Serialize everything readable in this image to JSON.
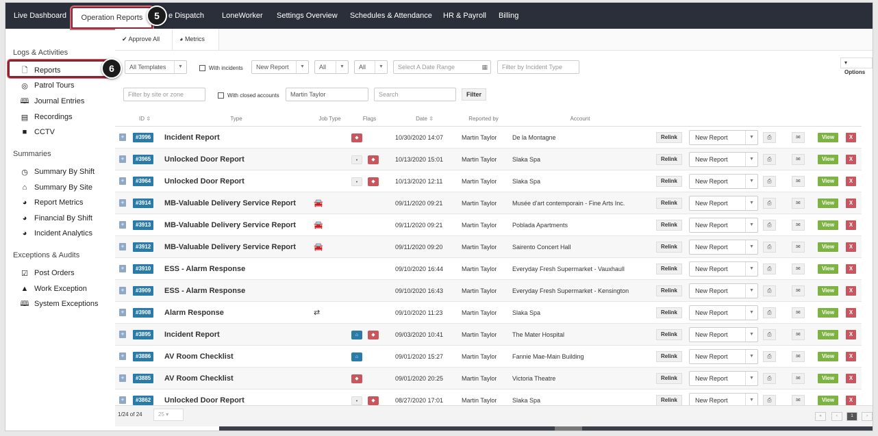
{
  "topnav": {
    "items": [
      "Live Dashboard",
      "Operation Reports",
      "e Dispatch",
      "LoneWorker",
      "Settings Overview",
      "Schedules & Attendance",
      "HR & Payroll",
      "Billing"
    ],
    "callout_nav": "5",
    "callout_side": "6"
  },
  "sidebar": {
    "logs_title": "Logs & Activities",
    "logs": [
      "Reports",
      "Patrol Tours",
      "Journal Entries",
      "Recordings",
      "CCTV"
    ],
    "summaries_title": "Summaries",
    "summaries": [
      "Summary By Shift",
      "Summary By Site",
      "Report Metrics",
      "Financial By Shift",
      "Incident Analytics"
    ],
    "exceptions_title": "Exceptions & Audits",
    "exceptions": [
      "Post Orders",
      "Work Exception",
      "System Exceptions"
    ]
  },
  "subbar": {
    "approve_all": "Approve All",
    "metrics": "Metrics"
  },
  "filters": {
    "templates": "All Templates",
    "with_incidents": "With incidents",
    "new_report": "New Report",
    "all1": "All",
    "all2": "All",
    "date_placeholder": "Select A Date Range",
    "incident_placeholder": "Filter by Incident Type",
    "options": "Options",
    "site_placeholder": "Filter by site or zone",
    "with_closed": "With closed accounts",
    "reporter": "Martin Taylor",
    "search_placeholder": "Search",
    "filter_button": "Filter"
  },
  "table": {
    "headers": [
      "ID",
      "Type",
      "Job Type",
      "Flags",
      "Date",
      "Reported by",
      "Account"
    ],
    "relink_label": "Relink",
    "select_label": "New Report",
    "view_label": "View",
    "delete_label": "X",
    "rows": [
      {
        "id": "#3996",
        "type": "Incident Report",
        "job": "",
        "flags": [
          "tag"
        ],
        "date": "10/30/2020 14:07",
        "by": "Martin Taylor",
        "account": "De la Montagne"
      },
      {
        "id": "#3965",
        "type": "Unlocked Door Report",
        "job": "",
        "flags": [
          "loc",
          "tag"
        ],
        "date": "10/13/2020 15:01",
        "by": "Martin Taylor",
        "account": "Slaka Spa"
      },
      {
        "id": "#3964",
        "type": "Unlocked Door Report",
        "job": "",
        "flags": [
          "loc",
          "tag"
        ],
        "date": "10/13/2020 12:11",
        "by": "Martin Taylor",
        "account": "Slaka Spa"
      },
      {
        "id": "#3914",
        "type": "MB-Valuable Delivery Service Report",
        "job": "car",
        "flags": [],
        "date": "09/11/2020 09:21",
        "by": "Martin Taylor",
        "account": "Musée d'art contemporain - Fine Arts Inc."
      },
      {
        "id": "#3913",
        "type": "MB-Valuable Delivery Service Report",
        "job": "car",
        "flags": [],
        "date": "09/11/2020 09:21",
        "by": "Martin Taylor",
        "account": "Poblada Apartments"
      },
      {
        "id": "#3912",
        "type": "MB-Valuable Delivery Service Report",
        "job": "car",
        "flags": [],
        "date": "09/11/2020 09:20",
        "by": "Martin Taylor",
        "account": "Sairento Concert Hall"
      },
      {
        "id": "#3910",
        "type": "ESS - Alarm Response",
        "job": "",
        "flags": [],
        "date": "09/10/2020 16:44",
        "by": "Martin Taylor",
        "account": "Everyday Fresh Supermarket - Vauxhaull"
      },
      {
        "id": "#3909",
        "type": "ESS - Alarm Response",
        "job": "",
        "flags": [],
        "date": "09/10/2020 16:43",
        "by": "Martin Taylor",
        "account": "Everyday Fresh Supermarket - Kensington"
      },
      {
        "id": "#3908",
        "type": "Alarm Response",
        "job": "swap",
        "flags": [],
        "date": "09/10/2020 11:23",
        "by": "Martin Taylor",
        "account": "Slaka Spa"
      },
      {
        "id": "#3895",
        "type": "Incident Report",
        "job": "",
        "flags": [
          "home",
          "tag"
        ],
        "date": "09/03/2020 10:41",
        "by": "Martin Taylor",
        "account": "The Mater Hospital"
      },
      {
        "id": "#3886",
        "type": "AV Room Checklist",
        "job": "",
        "flags": [
          "home"
        ],
        "date": "09/01/2020 15:27",
        "by": "Martin Taylor",
        "account": "Fannie Mae-Main Building"
      },
      {
        "id": "#3885",
        "type": "AV Room Checklist",
        "job": "",
        "flags": [
          "tag"
        ],
        "date": "09/01/2020 20:25",
        "by": "Martin Taylor",
        "account": "Victoria Theatre"
      },
      {
        "id": "#3862",
        "type": "Unlocked Door Report",
        "job": "",
        "flags": [
          "loc",
          "tag"
        ],
        "date": "08/27/2020 17:01",
        "by": "Martin Taylor",
        "account": "Slaka Spa"
      }
    ]
  },
  "footer": {
    "page_info": "1/24 of 24",
    "page_size": "25",
    "current_page": "1"
  }
}
